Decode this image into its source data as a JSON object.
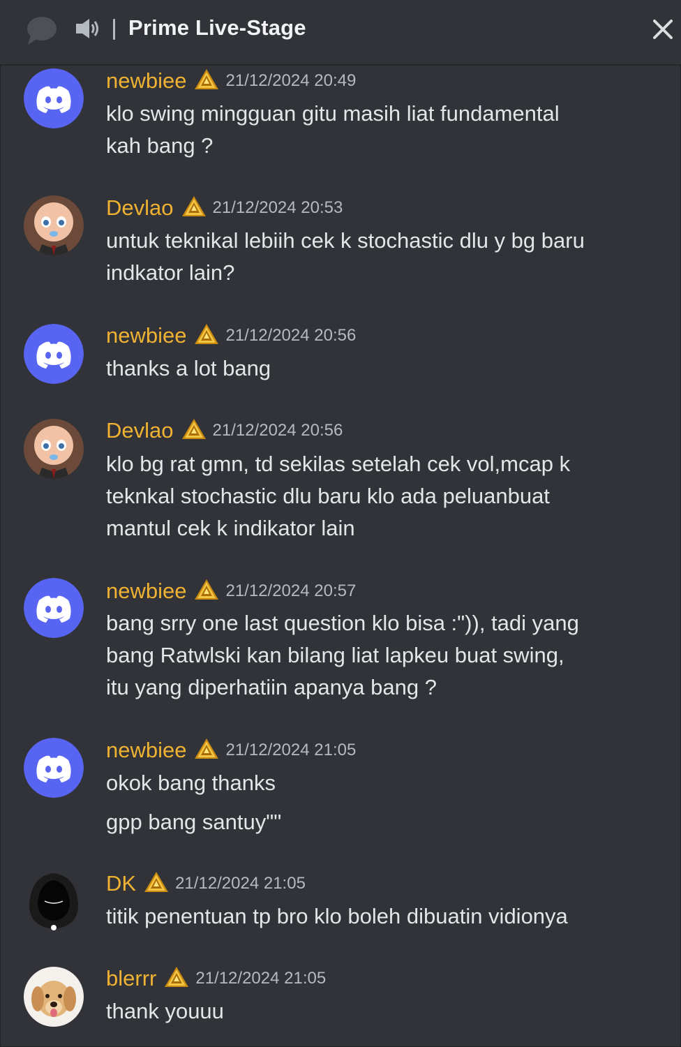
{
  "header": {
    "title": "Prime Live-Stage",
    "icons": [
      "thread-icon",
      "speaker-icon",
      "close-icon"
    ]
  },
  "messages": [
    {
      "username": "newbiee",
      "avatar": "discord-logo",
      "timestamp": "21/12/2024 20:49",
      "lines": [
        "klo swing mingguan gitu masih liat fundamental\nkah bang ?"
      ]
    },
    {
      "username": "Devlao",
      "avatar": "baby-character",
      "timestamp": "21/12/2024 20:53",
      "lines": [
        "untuk teknikal lebiih cek k stochastic dlu y bg baru\nindkator lain?"
      ]
    },
    {
      "username": "newbiee",
      "avatar": "discord-logo",
      "timestamp": "21/12/2024 20:56",
      "lines": [
        "thanks a lot bang"
      ]
    },
    {
      "username": "Devlao",
      "avatar": "baby-character",
      "timestamp": "21/12/2024 20:56",
      "lines": [
        "klo bg rat gmn, td sekilas setelah cek vol,mcap k\nteknkal stochastic dlu baru klo ada peluanbuat\nmantul cek k indikator lain"
      ]
    },
    {
      "username": "newbiee",
      "avatar": "discord-logo",
      "timestamp": "21/12/2024 20:57",
      "lines": [
        "bang srry one last question klo bisa :\")), tadi yang\nbang Ratwlski kan bilang liat lapkeu buat swing,\nitu yang diperhatiin apanya bang ?"
      ]
    },
    {
      "username": "newbiee",
      "avatar": "discord-logo",
      "timestamp": "21/12/2024 21:05",
      "lines": [
        "okok bang thanks",
        "gpp bang santuy\"\""
      ]
    },
    {
      "username": "DK",
      "avatar": "hooded-figure",
      "timestamp": "21/12/2024 21:05",
      "lines": [
        "titik penentuan tp bro klo boleh dibuatin vidionya"
      ]
    },
    {
      "username": "blerrr",
      "avatar": "puppy-photo",
      "timestamp": "21/12/2024 21:05",
      "lines": [
        "thank youuu"
      ]
    }
  ],
  "colors": {
    "background": "#313338",
    "username": "#f0b232",
    "timestamp": "#b5bac1",
    "text": "#e3e5e8",
    "discord_blurple": "#5865f2"
  }
}
